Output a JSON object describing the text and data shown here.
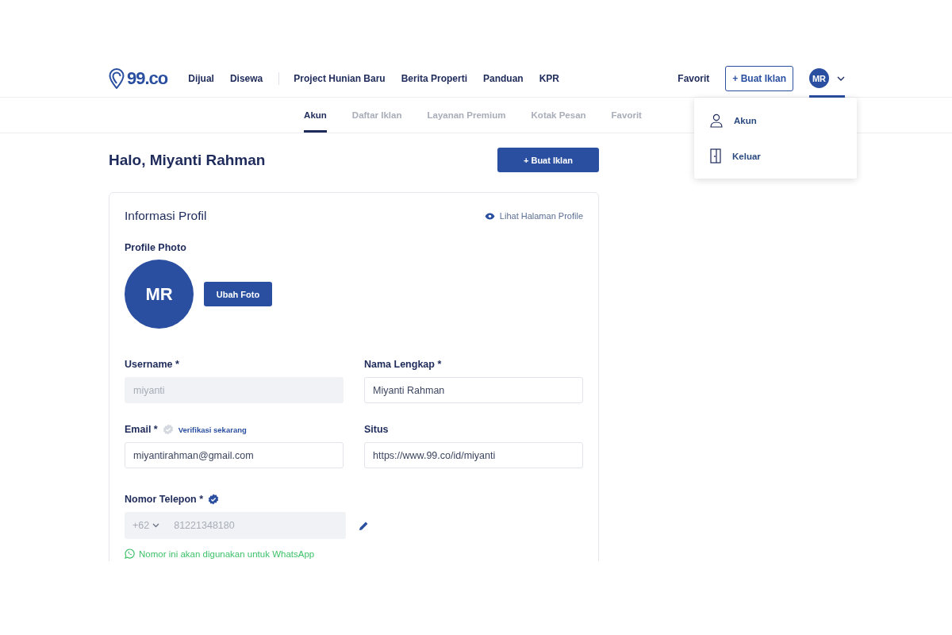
{
  "nav": {
    "logo": "99.co",
    "primary_links": [
      "Dijual",
      "Disewa"
    ],
    "secondary_links": [
      "Project Hunian Baru",
      "Berita Properti",
      "Panduan",
      "KPR"
    ],
    "favorite": "Favorit",
    "create_button": "+ Buat Iklan",
    "avatar": "MR",
    "menu_expanded": true
  },
  "tabs": [
    {
      "label": "Akun",
      "selected": true
    },
    {
      "label": "Daftar Iklan",
      "selected": false
    },
    {
      "label": "Layanan Premium",
      "selected": false
    },
    {
      "label": "Kotak Pesan",
      "selected": false
    },
    {
      "label": "Favorit",
      "selected": false
    }
  ],
  "menu": [
    {
      "label": "Akun",
      "kind": "person"
    },
    {
      "label": "Keluar",
      "kind": "door"
    }
  ],
  "greeting": "Halo, Miyanti Rahman",
  "create_button": "+ Buat Iklan",
  "profile": {
    "title": "Informasi Profil",
    "view_link": "Lihat Halaman Profile",
    "photo_label": "Profile Photo",
    "avatar": "MR",
    "change_photo": "Ubah Foto",
    "fields": [
      {
        "label": "Username *",
        "value": "miyanti",
        "disabled": true
      },
      {
        "label": "Nama Lengkap *",
        "value": "Miyanti Rahman",
        "disabled": false
      },
      {
        "label": "Email *",
        "value": "miyantirahman@gmail.com",
        "disabled": false,
        "verified": false,
        "verify_link": "Verifikasi sekarang"
      },
      {
        "label": "Situs",
        "value": "https://www.99.co/id/miyanti",
        "disabled": false
      }
    ],
    "phone": {
      "label": "Nomor Telepon *",
      "verified": true,
      "country_code": "+62",
      "value": "81221348180",
      "disabled": true,
      "note": "Nomor ini akan digunakan untuk WhatsApp"
    }
  }
}
